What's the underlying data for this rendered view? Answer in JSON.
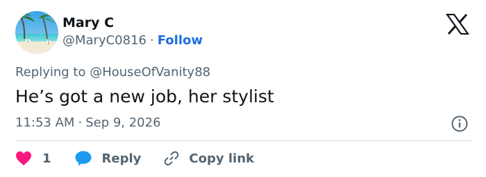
{
  "author": {
    "name": "Mary C",
    "handle": "@MaryC0816",
    "separator": "·",
    "follow_label": "Follow"
  },
  "reply_context": {
    "prefix": "Replying to",
    "mention": "@HouseOfVanity88"
  },
  "tweet": {
    "text": "He’s got a new job, her stylist",
    "time": "11:53 AM",
    "separator": "·",
    "date": "Sep 9, 2026"
  },
  "actions": {
    "like_count": "1",
    "reply_label": "Reply",
    "copy_link_label": "Copy link"
  },
  "icons": {
    "avatar": "beach-avatar",
    "logo": "x-logo-icon",
    "info": "info-icon",
    "like": "heart-icon",
    "reply": "speech-bubble-icon",
    "copy": "link-icon"
  },
  "colors": {
    "link_blue": "#1d6fe0",
    "like_pink": "#f91880",
    "reply_blue": "#1d9bf0",
    "muted_text": "#536471",
    "primary_text": "#0f1419"
  }
}
